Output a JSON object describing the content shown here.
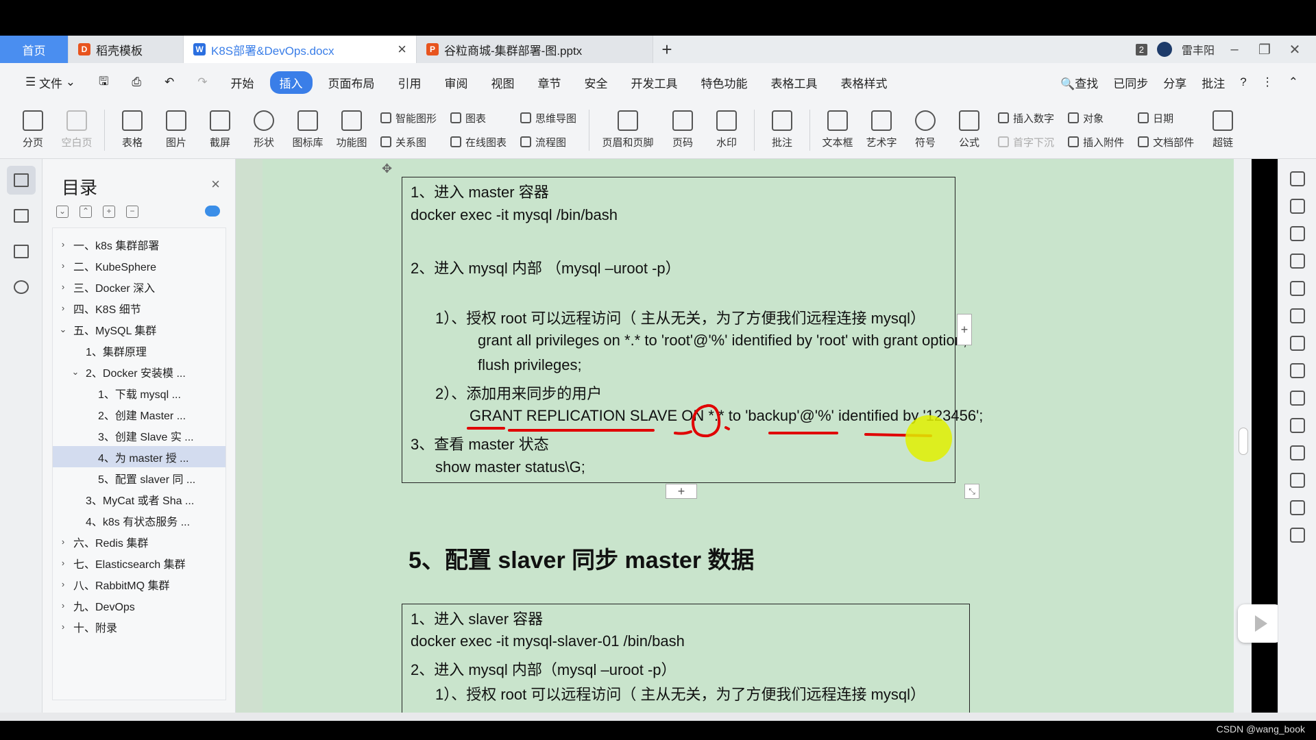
{
  "tabs": {
    "home": "首页",
    "template": "稻壳模板",
    "doc": "K8S部署&DevOps.docx",
    "ppt": "谷粒商城-集群部署-图.pptx",
    "new": "+",
    "badge": "2",
    "user": "雷丰阳"
  },
  "menu": {
    "file": "文件",
    "items": [
      "开始",
      "插入",
      "页面布局",
      "引用",
      "审阅",
      "视图",
      "章节",
      "安全",
      "开发工具",
      "特色功能",
      "表格工具",
      "表格样式"
    ],
    "active": "插入",
    "search": "查找",
    "sync": "已同步",
    "share": "分享",
    "annotate": "批注"
  },
  "ribbon": {
    "pagebreak": "分页",
    "blankpage": "空白页",
    "table": "表格",
    "picture": "图片",
    "screenshot": "截屏",
    "shape": "形状",
    "iconlib": "图标库",
    "funcchart": "功能图",
    "smartart": "智能图形",
    "chart": "图表",
    "relation": "关系图",
    "onlinechart": "在线图表",
    "mindmap": "思维导图",
    "flowchart": "流程图",
    "headerfooter": "页眉和页脚",
    "pagenum": "页码",
    "watermark": "水印",
    "comment": "批注",
    "textbox": "文本框",
    "wordart": "艺术字",
    "symbol": "符号",
    "formula": "公式",
    "insertnum": "插入数字",
    "object": "对象",
    "date": "日期",
    "dropcap": "首字下沉",
    "attach": "插入附件",
    "docpart": "文档部件",
    "hyperlink": "超链"
  },
  "toc": {
    "title": "目录",
    "items": [
      {
        "label": "一、k8s 集群部署",
        "level": 0,
        "arrow": "›"
      },
      {
        "label": "二、KubeSphere",
        "level": 0,
        "arrow": "›"
      },
      {
        "label": "三、Docker 深入",
        "level": 0,
        "arrow": "›"
      },
      {
        "label": "四、K8S 细节",
        "level": 0,
        "arrow": "›"
      },
      {
        "label": "五、MySQL 集群",
        "level": 0,
        "arrow": "⌄"
      },
      {
        "label": "1、集群原理",
        "level": 1,
        "arrow": ""
      },
      {
        "label": "2、Docker 安装模 ...",
        "level": 1,
        "arrow": "⌄"
      },
      {
        "label": "1、下载 mysql ...",
        "level": 2,
        "arrow": ""
      },
      {
        "label": "2、创建 Master ...",
        "level": 2,
        "arrow": ""
      },
      {
        "label": "3、创建 Slave 实 ...",
        "level": 2,
        "arrow": ""
      },
      {
        "label": "4、为 master 授 ...",
        "level": 2,
        "arrow": "",
        "selected": true
      },
      {
        "label": "5、配置 slaver 同 ...",
        "level": 2,
        "arrow": ""
      },
      {
        "label": "3、MyCat 或者 Sha ...",
        "level": 1,
        "arrow": ""
      },
      {
        "label": "4、k8s 有状态服务 ...",
        "level": 1,
        "arrow": ""
      },
      {
        "label": "六、Redis 集群",
        "level": 0,
        "arrow": "›"
      },
      {
        "label": "七、Elasticsearch 集群",
        "level": 0,
        "arrow": "›"
      },
      {
        "label": "八、RabbitMQ 集群",
        "level": 0,
        "arrow": "›"
      },
      {
        "label": "九、DevOps",
        "level": 0,
        "arrow": "›"
      },
      {
        "label": "十、附录",
        "level": 0,
        "arrow": "›"
      }
    ]
  },
  "doc": {
    "box1": {
      "l1": "1、进入 master 容器",
      "l2": "docker exec -it mysql /bin/bash",
      "l3": "2、进入 mysql 内部  （mysql –uroot -p）",
      "l4": "1）、授权 root 可以远程访问（ 主从无关，为了方便我们远程连接 mysql）",
      "l5": "grant all privileges on *.* to 'root'@'%' identified by 'root' with grant option;",
      "l6": "flush privileges;",
      "l7": "2）、添加用来同步的用户",
      "l8": "GRANT REPLICATION SLAVE ON *.* to 'backup'@'%' identified by '123456';",
      "l9": "3、查看 master 状态",
      "l10": "show master status\\G;"
    },
    "heading": "5、配置 slaver 同步 master 数据",
    "box2": {
      "l1": "1、进入 slaver 容器",
      "l2": "docker exec -it mysql-slaver-01 /bin/bash",
      "l3": "2、进入 mysql 内部（mysql –uroot -p）",
      "l4": "1）、授权 root 可以远程访问（ 主从无关，为了方便我们远程连接 mysql）"
    }
  },
  "watermark": "CSDN @wang_book",
  "colors": {
    "accent": "#3a7ee8",
    "page": "#c9e4cc",
    "annotation": "#e00000"
  }
}
